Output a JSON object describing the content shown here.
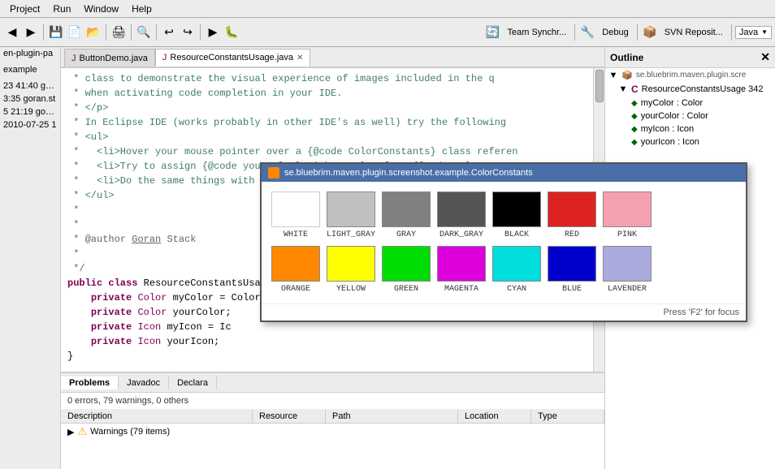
{
  "menu": {
    "items": [
      "Project",
      "Run",
      "Window",
      "Help"
    ]
  },
  "toolbar": {
    "team_sync_label": "Team Synchr...",
    "debug_label": "Debug",
    "svn_label": "SVN Reposit...",
    "java_label": "Java"
  },
  "tabs": {
    "items": [
      {
        "label": "ButtonDemo.java",
        "active": false
      },
      {
        "label": "ResourceConstantsUsage.java",
        "active": true
      }
    ]
  },
  "editor": {
    "lines": [
      {
        "num": "",
        "code": " * class to demonstrate the visual experience of images included in the q",
        "type": "comment"
      },
      {
        "num": "",
        "code": " * when activating code completion in your IDE.",
        "type": "comment"
      },
      {
        "num": "",
        "code": " * </p>",
        "type": "comment"
      },
      {
        "num": "",
        "code": " * In Eclipse IDE (works probably in other IDE's as well) try the following",
        "type": "comment"
      },
      {
        "num": "",
        "code": " * <ul>",
        "type": "comment"
      },
      {
        "num": "",
        "code": " *   <li>Hover your mouse pointer over a {@code ColorConstants} class referen",
        "type": "comment"
      },
      {
        "num": "",
        "code": " *   <li>Try to assign {@code yourColor} with a color from {@code ColorConsta",
        "type": "comment"
      },
      {
        "num": "",
        "code": " *   <li>Do the same things with {@code IconConstants}",
        "type": "comment"
      },
      {
        "num": "",
        "code": " * </ul>",
        "type": "comment"
      },
      {
        "num": "",
        "code": " *",
        "type": "comment"
      },
      {
        "num": "",
        "code": " *",
        "type": "comment"
      },
      {
        "num": "",
        "code": " * @author Goran Stack",
        "type": "annotation"
      },
      {
        "num": "",
        "code": " *",
        "type": "comment"
      },
      {
        "num": "",
        "code": " */",
        "type": "comment"
      },
      {
        "num": "",
        "code": "public class ResourceConstantsUsage {",
        "type": "keyword"
      },
      {
        "num": "",
        "code": "",
        "type": "normal"
      },
      {
        "num": "",
        "code": "    private Color myColor = ColorConstants.TRANSPARENT_BLUE;",
        "type": "mixed"
      },
      {
        "num": "",
        "code": "    private Color yourColor;",
        "type": "mixed"
      },
      {
        "num": "",
        "code": "    private Icon myIcon = Ic",
        "type": "mixed"
      },
      {
        "num": "",
        "code": "    private Icon yourIcon;",
        "type": "mixed"
      },
      {
        "num": "",
        "code": "",
        "type": "normal"
      },
      {
        "num": "",
        "code": "}",
        "type": "normal"
      }
    ]
  },
  "left_sidebar": {
    "items": [
      "en-plugin-pa",
      "",
      "example",
      "",
      "23 41:40 gora",
      "3:35  goran.st",
      "5 21:19  goran",
      "2010-07-25 1"
    ]
  },
  "outline": {
    "title": "Outline",
    "tree": [
      {
        "label": "se.bluebrim.maven.plugin.scre",
        "type": "package",
        "indent": 0,
        "expanded": true
      },
      {
        "label": "ResourceConstantsUsage 342",
        "type": "class",
        "indent": 1,
        "expanded": true
      },
      {
        "label": "myColor : Color",
        "type": "field",
        "indent": 2
      },
      {
        "label": "yourColor : Color",
        "type": "field",
        "indent": 2
      },
      {
        "label": "myIcon : Icon",
        "type": "field",
        "indent": 2
      },
      {
        "label": "yourIcon : Icon",
        "type": "field",
        "indent": 2
      }
    ]
  },
  "bottom": {
    "tabs": [
      "Problems",
      "Javadoc",
      "Declara"
    ],
    "active_tab": "Problems",
    "summary": "0 errors, 79 warnings, 0 others",
    "columns": [
      "Description",
      "Resource",
      "Path",
      "Location",
      "Type"
    ],
    "warnings_label": "Warnings (79 items)"
  },
  "color_popup": {
    "title": "se.bluebrim.maven.plugin.screenshot.example.ColorConstants",
    "footer": "Press 'F2' for focus",
    "colors_row1": [
      {
        "label": "WHITE",
        "hex": "#FFFFFF"
      },
      {
        "label": "LIGHT_GRAY",
        "hex": "#C0C0C0"
      },
      {
        "label": "GRAY",
        "hex": "#808080"
      },
      {
        "label": "DARK_GRAY",
        "hex": "#555555"
      },
      {
        "label": "BLACK",
        "hex": "#000000"
      },
      {
        "label": "RED",
        "hex": "#DD2222"
      },
      {
        "label": "PINK",
        "hex": "#F4A0B0"
      }
    ],
    "colors_row2": [
      {
        "label": "ORANGE",
        "hex": "#FF8800"
      },
      {
        "label": "YELLOW",
        "hex": "#FFFF00"
      },
      {
        "label": "GREEN",
        "hex": "#00DD00"
      },
      {
        "label": "MAGENTA",
        "hex": "#DD00DD"
      },
      {
        "label": "CYAN",
        "hex": "#00DDDD"
      },
      {
        "label": "BLUE",
        "hex": "#0000CC"
      },
      {
        "label": "LAVENDER",
        "hex": "#AAAADD"
      }
    ]
  }
}
